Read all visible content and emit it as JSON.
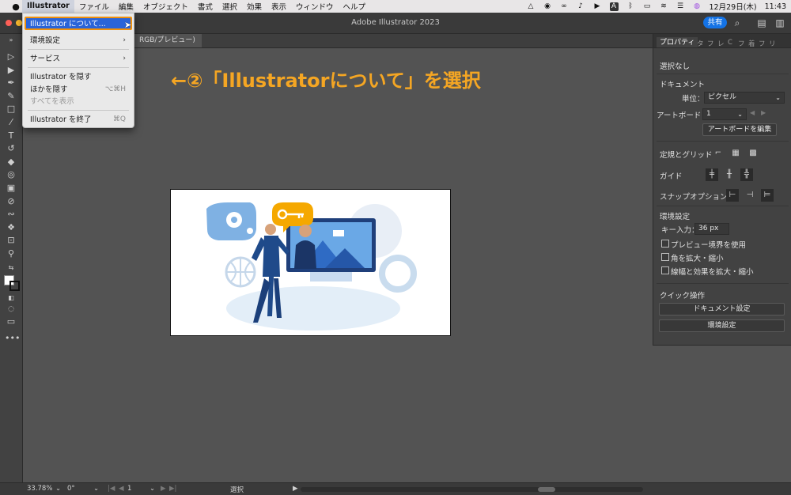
{
  "menubar": {
    "app": "Illustrator",
    "items": [
      "ファイル",
      "編集",
      "オブジェクト",
      "書式",
      "選択",
      "効果",
      "表示",
      "ウィンドウ",
      "ヘルプ"
    ],
    "date": "12月29日(木)",
    "time": "11:43",
    "status_icons": [
      "triangle-icon",
      "line-icon",
      "creative-cloud-icon",
      "music-icon",
      "play-icon",
      "a-icon",
      "bluetooth-icon",
      "battery-icon",
      "wifi-icon",
      "control-center-icon",
      "siri-icon"
    ]
  },
  "titlebar": {
    "title": "Adobe Illustrator 2023",
    "share_label": "共有"
  },
  "doc_tab": {
    "label": "RGB/プレビュー)"
  },
  "app_menu": {
    "items": [
      {
        "label": "Illustrator について...",
        "shortcut": "",
        "state": "highlighted"
      },
      {
        "label": "環境設定",
        "shortcut": "›",
        "state": "normal"
      },
      {
        "label": "サービス",
        "shortcut": "›",
        "state": "normal"
      },
      {
        "label": "Illustrator を隠す",
        "shortcut": "",
        "state": "normal"
      },
      {
        "label": "ほかを隠す",
        "shortcut": "⌥⌘H",
        "state": "normal"
      },
      {
        "label": "すべてを表示",
        "shortcut": "",
        "state": "disabled"
      },
      {
        "label": "Illustrator を終了",
        "shortcut": "⌘Q",
        "state": "normal"
      }
    ]
  },
  "annotation": {
    "text": "←②「Illustratorについて」を選択",
    "color": "#f5a623"
  },
  "properties_panel": {
    "tabs": [
      "プロパティ",
      "タ",
      "フ",
      "レ",
      "C",
      "フ",
      "着",
      "フ",
      "リ"
    ],
    "selection": "選択なし",
    "document_heading": "ドキュメント",
    "unit_label": "単位：",
    "unit_value": "ピクセル",
    "artboard_label": "アートボード：",
    "artboard_value": "1",
    "edit_artboard": "アートボードを編集",
    "rulers_grid": "定規とグリッド",
    "guides": "ガイド",
    "snap_options": "スナップオプション",
    "preferences_heading": "環境設定",
    "key_input_label": "キー入力：",
    "key_input_value": "36 px",
    "checkboxes": [
      "プレビュー境界を使用",
      "角を拡大・縮小",
      "線幅と効果を拡大・縮小"
    ],
    "quick_actions": "クイック操作",
    "doc_setup_button": "ドキュメント設定",
    "prefs_button": "環境設定"
  },
  "statusbar": {
    "zoom": "33.78%",
    "rotation": "0°",
    "artboard": "1",
    "tool": "選択"
  },
  "colors": {
    "accent": "#1473e6",
    "highlight": "#2a64d8",
    "annotation_border": "#f0900a"
  }
}
